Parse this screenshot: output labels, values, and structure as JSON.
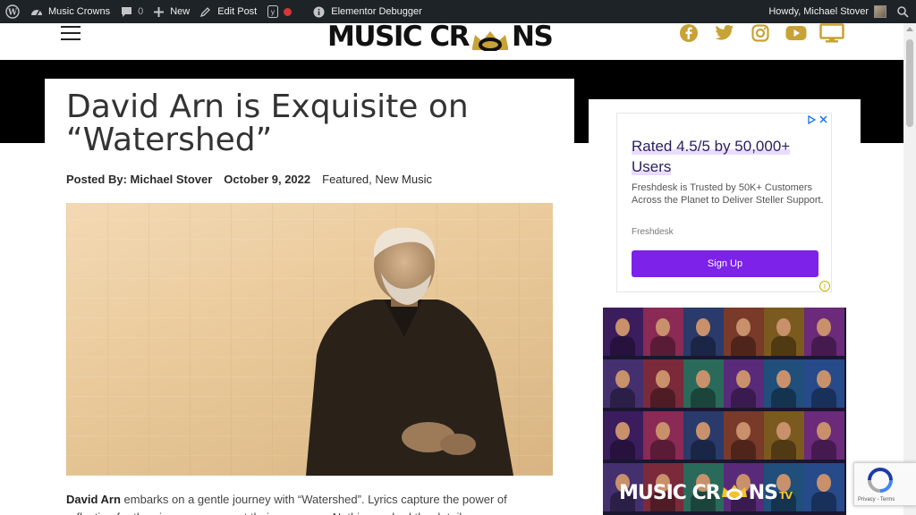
{
  "admin_bar": {
    "site_name": "Music Crowns",
    "comments_count": "0",
    "new_label": "New",
    "edit_post_label": "Edit Post",
    "debugger_label": "Elementor Debugger",
    "howdy": "Howdy, Michael Stover"
  },
  "site": {
    "logo_left": "MUSIC CR",
    "logo_right": "NS",
    "socials": [
      "facebook-icon",
      "twitter-icon",
      "instagram-icon",
      "youtube-icon",
      "tv-icon"
    ],
    "accent_color": "#c7a236"
  },
  "post": {
    "title": "David Arn is Exquisite on “Watershed”",
    "posted_by_label": "Posted By:",
    "author": "Michael Stover",
    "date": "October 9, 2022",
    "category_1": "Featured",
    "category_sep": ",",
    "category_2": "New Music",
    "intro_name": "David Arn",
    "intro_text": " embarks on a gentle journey with “Watershed”. Lyrics capture the power of reflection for the pieces move on at their own pace. Nothing rushed the details"
  },
  "ad": {
    "headline": "Rated 4.5/5 by 50,000+ Users",
    "description": "Freshdesk is Trusted by 50K+ Customers Across the Planet to Deliver Steller Support.",
    "brand": "Freshdesk",
    "cta": "Sign Up",
    "button_color": "#7d22e8"
  },
  "promo": {
    "logo_left": "MUSIC CR",
    "logo_right": "NS",
    "logo_suffix": "TV"
  },
  "recaptcha": {
    "terms": "Privacy - Terms"
  }
}
